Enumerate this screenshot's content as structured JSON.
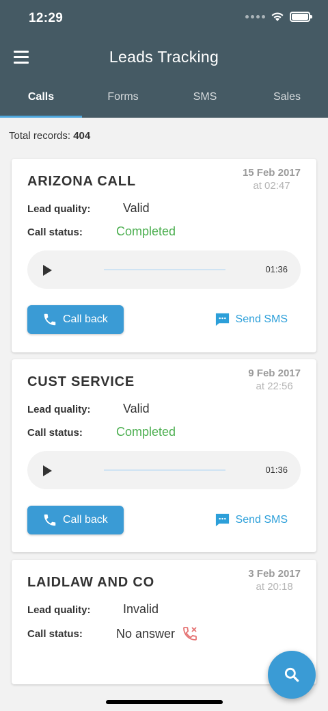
{
  "status_bar": {
    "time": "12:29"
  },
  "app": {
    "title": "Leads Tracking",
    "tabs": [
      {
        "label": "Calls",
        "active": true
      },
      {
        "label": "Forms",
        "active": false
      },
      {
        "label": "SMS",
        "active": false
      },
      {
        "label": "Sales",
        "active": false
      }
    ]
  },
  "summary": {
    "label": "Total records:",
    "count": "404"
  },
  "records": [
    {
      "title": "ARIZONA CALL",
      "date": "15 Feb 2017",
      "time": "at 02:47",
      "lead_quality_label": "Lead quality:",
      "lead_quality": "Valid",
      "call_status_label": "Call status:",
      "call_status": "Completed",
      "duration": "01:36",
      "call_back_label": "Call back",
      "send_sms_label": "Send SMS"
    },
    {
      "title": "CUST SERVICE",
      "date": "9 Feb 2017",
      "time": "at 22:56",
      "lead_quality_label": "Lead quality:",
      "lead_quality": "Valid",
      "call_status_label": "Call status:",
      "call_status": "Completed",
      "duration": "01:36",
      "call_back_label": "Call back",
      "send_sms_label": "Send SMS"
    },
    {
      "title": "LAIDLAW AND CO",
      "date": "3 Feb 2017",
      "time": "at 20:18",
      "lead_quality_label": "Lead quality:",
      "lead_quality": "Invalid",
      "call_status_label": "Call status:",
      "call_status": "No answer",
      "status_icon": "missed-call-icon"
    }
  ],
  "colors": {
    "header": "#455a64",
    "accent": "#3a9bd5",
    "completed": "#4caf50",
    "missed": "#e57373"
  }
}
